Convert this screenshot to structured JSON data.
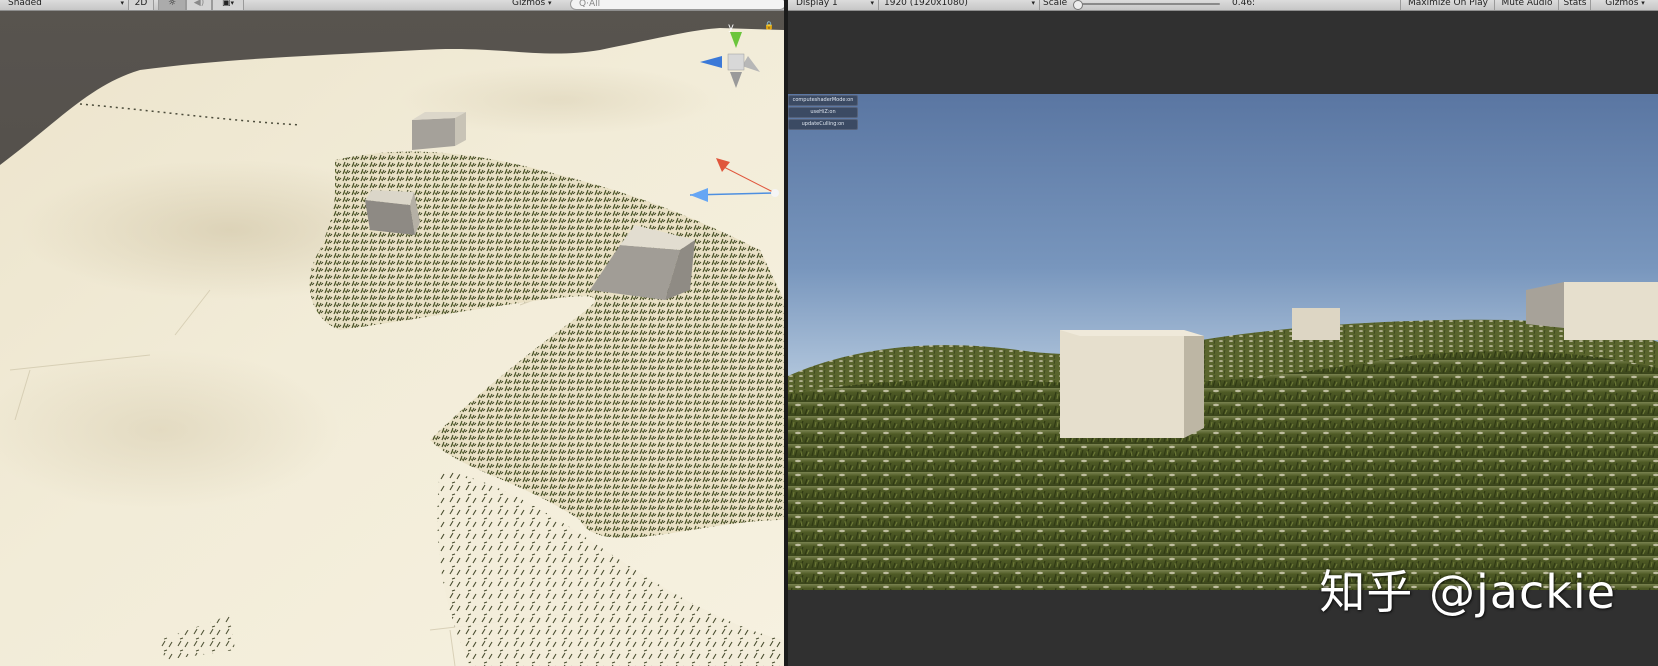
{
  "scene_view": {
    "shading_mode": "Shaded",
    "mode_2d": "2D",
    "lighting_icon": "sun-icon",
    "audio_icon": "speaker-icon",
    "effects_icon": "image-icon",
    "gizmos_label": "Gizmos",
    "search_placeholder": "Q·All",
    "lock_icon": "lock-icon",
    "gizmo_axis_label": "y"
  },
  "game_view": {
    "display": "Display 1",
    "resolution": "1920 (1920x1080)",
    "scale_label": "Scale",
    "scale_value_text": "0.46:",
    "scale_value": 0.46,
    "maximize_label": "Maximize On Play",
    "mute_label": "Mute Audio",
    "stats_label": "Stats",
    "gizmos_label": "Gizmos",
    "debug_buttons": [
      "computeshaderMode:on",
      "useHiZ:on",
      "updateCulling:on"
    ]
  },
  "watermark": "知乎 @jackie",
  "colors": {
    "toolbar": "#d2d2d2",
    "terrain": "#efe8d3",
    "grass": "#4b5a24",
    "sky_top": "#5e7aa6",
    "sky_horizon": "#d4e2ee",
    "cube": "#e7e0ce"
  }
}
